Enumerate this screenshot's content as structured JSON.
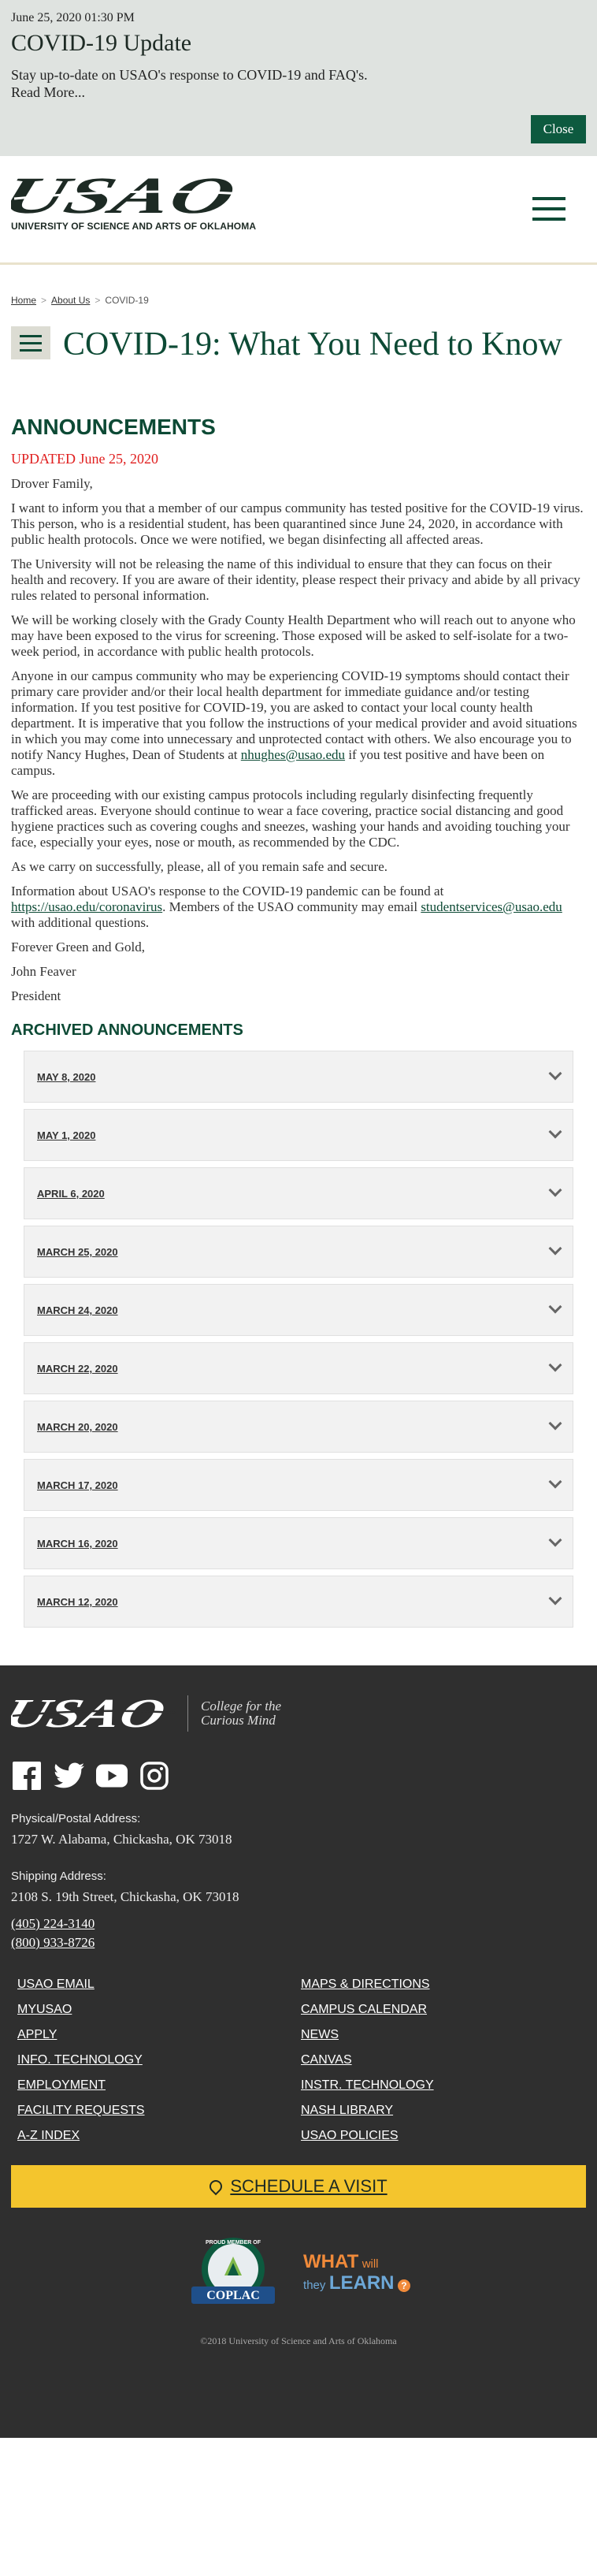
{
  "alert": {
    "date": "June 25, 2020 01:30 PM",
    "title": "COVID-19 Update",
    "text": "Stay up-to-date on USAO's response to COVID-19 and FAQ's.",
    "read_more": "Read More...",
    "close_label": "Close"
  },
  "header": {
    "logo_text": "USAO",
    "logo_subtitle": "UNIVERSITY OF SCIENCE AND ARTS OF OKLAHOMA"
  },
  "breadcrumb": {
    "items": [
      "Home",
      "About Us",
      "COVID-19"
    ]
  },
  "page": {
    "title": "COVID-19: What You Need to Know"
  },
  "announcements": {
    "heading": "ANNOUNCEMENTS",
    "updated": "UPDATED June 25, 2020",
    "greeting": "Drover Family,",
    "p1": "I want to inform you that a member of our campus community has tested positive for the COVID-19 virus. This person, who is a residential student, has been quarantined since June 24, 2020, in accordance with public health protocols. Once we were notified, we began disinfecting all affected areas.",
    "p2": "The University will not be releasing the name of this individual to ensure that they can focus on their health and recovery. If you are aware of their identity, please respect their privacy and abide by all privacy rules related to personal information.",
    "p3": "We will be working closely with the Grady County Health Department who will reach out to anyone who may have been exposed to the virus for screening. Those exposed will be asked to self-isolate for a two-week period, in accordance with public health protocols.",
    "p4_before": "Anyone in our campus community who may be experiencing COVID-19 symptoms should contact their primary care provider and/or their local health department for immediate guidance and/or testing information. If you test positive for COVID-19, you are asked to contact your local county health department. It is imperative that you follow the instructions of your medical provider and avoid situations in which you may come into unnecessary and unprotected contact with others. We also encourage you to notify Nancy Hughes, Dean of Students at ",
    "p4_link": "nhughes@usao.edu",
    "p4_after": " if you test positive and have been on campus.",
    "p5": "We are proceeding with our existing campus protocols including regularly disinfecting frequently trafficked areas. Everyone should continue to wear a face covering, practice social distancing and good hygiene practices such as covering coughs and sneezes, washing your hands and avoiding touching your face, especially your eyes, nose or mouth, as recommended by the CDC.",
    "p6": "As we carry on successfully, please, all of you remain safe and secure.",
    "p7_before": "Information about USAO's response to the COVID-19 pandemic can be found at ",
    "p7_link1": "https://usao.edu/coronavirus",
    "p7_mid": ". Members of the USAO community may email ",
    "p7_link2": "studentservices@usao.edu",
    "p7_after": " with additional questions.",
    "closing": "Forever Green and Gold,",
    "signer": "John Feaver",
    "signer_title": "President"
  },
  "archived": {
    "heading": "ARCHIVED ANNOUNCEMENTS",
    "items": [
      "MAY 8, 2020",
      "MAY 1, 2020",
      "APRIL 6, 2020",
      "MARCH 25, 2020",
      "MARCH 24, 2020",
      "MARCH 22, 2020",
      "MARCH 20, 2020",
      "MARCH 17, 2020",
      "MARCH 16, 2020",
      "MARCH 12, 2020"
    ]
  },
  "footer": {
    "logo_text": "USAO",
    "tagline_1": "College for the",
    "tagline_2": "Curious Mind",
    "physical_label": "Physical/Postal Address:",
    "physical_address": "1727 W. Alabama, Chickasha, OK 73018",
    "shipping_label": "Shipping Address:",
    "shipping_address": "2108 S. 19th Street, Chickasha, OK 73018",
    "phone_1": "(405) 224-3140",
    "phone_2": "(800) 933-8726",
    "links": [
      "USAO EMAIL",
      "MAPS & DIRECTIONS",
      "MYUSAO",
      "CAMPUS CALENDAR",
      "APPLY",
      "NEWS",
      "INFO. TECHNOLOGY",
      "CANVAS",
      "EMPLOYMENT",
      "INSTR. TECHNOLOGY",
      "FACILITY REQUESTS",
      "NASH LIBRARY",
      "A-Z INDEX",
      "USAO POLICIES"
    ],
    "schedule_visit": "SCHEDULE A VISIT",
    "coplac_top": "PROUD MEMBER OF",
    "coplac_name": "COPLAC",
    "wwtl_1": "WHAT",
    "wwtl_2": "will",
    "wwtl_3": "they",
    "wwtl_4": "LEARN",
    "copyright": "©2018 University of Science and Arts of Oklahoma"
  }
}
